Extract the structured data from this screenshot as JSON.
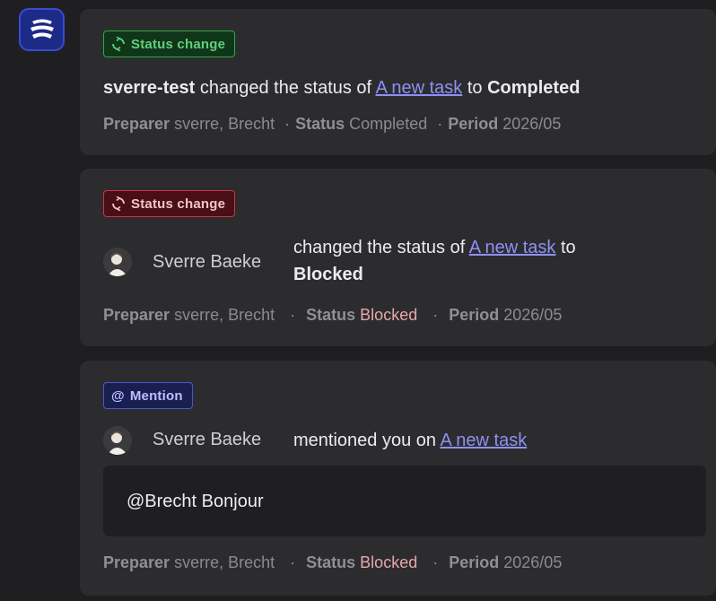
{
  "feed": [
    {
      "badge": "Status change",
      "actor": "sverre-test",
      "verb": "changed the status of",
      "task_link": "A new task",
      "to_word": "to",
      "new_status": "Completed",
      "meta": {
        "preparer_label": "Preparer",
        "preparer_value": "sverre, Brecht",
        "status_label": "Status",
        "status_value": "Completed",
        "period_label": "Period",
        "period_value": "2026/05"
      }
    },
    {
      "badge": "Status change",
      "user_name": "Sverre Baeke",
      "verb": "changed the status of",
      "task_link": "A new task",
      "to_word": "to",
      "new_status": "Blocked",
      "meta": {
        "preparer_label": "Preparer",
        "preparer_value": "sverre, Brecht",
        "status_label": "Status",
        "status_value": "Blocked",
        "period_label": "Period",
        "period_value": "2026/05"
      }
    },
    {
      "badge": "Mention",
      "user_name": "Sverre Baeke",
      "verb": "mentioned you on",
      "task_link": "A new task",
      "quote": "@Brecht Bonjour",
      "meta": {
        "preparer_label": "Preparer",
        "preparer_value": "sverre, Brecht",
        "status_label": "Status",
        "status_value": "Blocked",
        "period_label": "Period",
        "period_value": "2026/05"
      }
    }
  ],
  "meta_separator": "·",
  "icons": {
    "logo": "stacked-layers-logo",
    "status": "refresh-icon",
    "mention": "at-sign"
  },
  "colors": {
    "badge_green": "#61d07a",
    "badge_red": "#f4c4c8",
    "badge_blue": "#b9c0ff",
    "link": "#8f90f5",
    "blocked": "#e7a6ab"
  }
}
